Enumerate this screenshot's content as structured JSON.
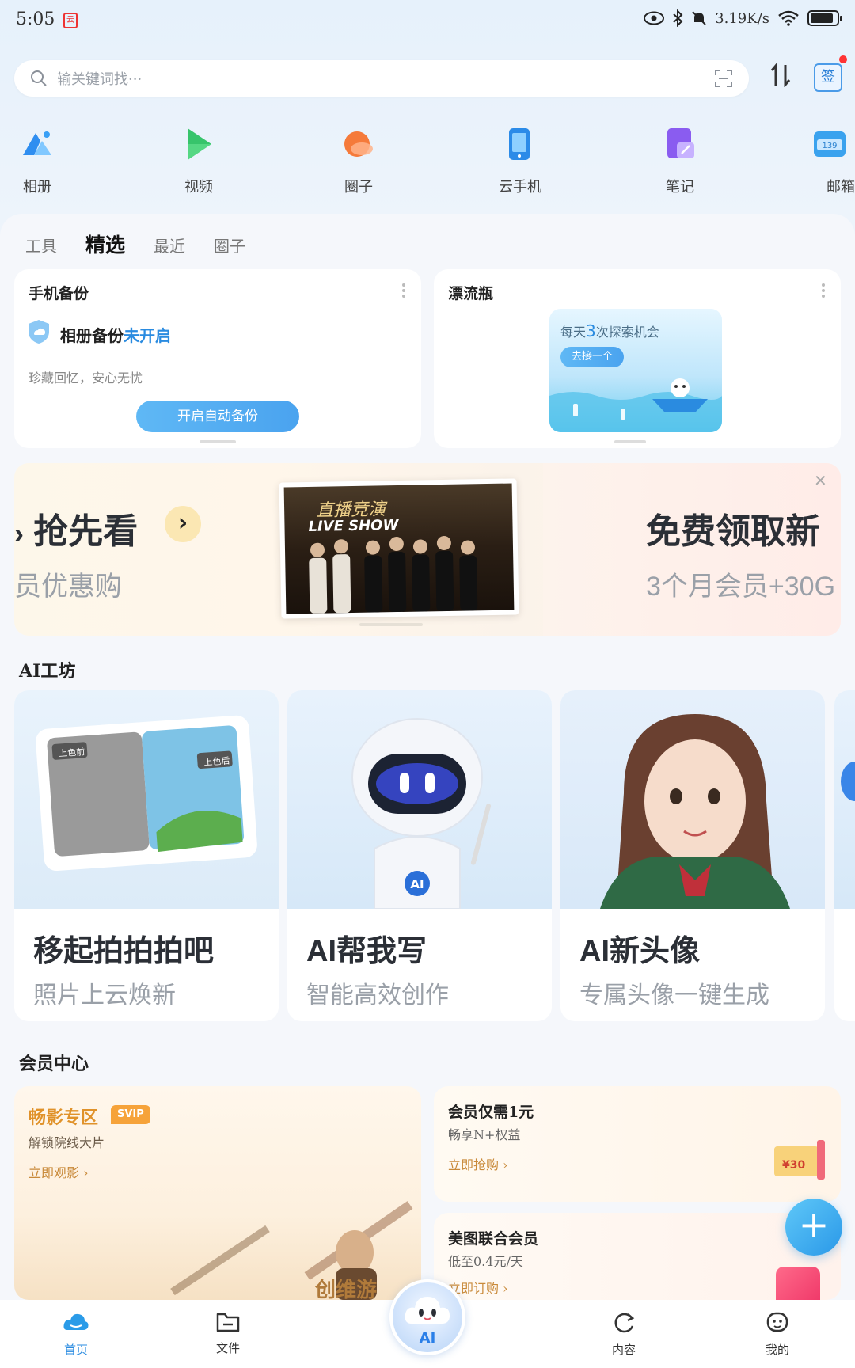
{
  "status_bar": {
    "time": "5:05",
    "network_speed": "3.19K/s"
  },
  "search": {
    "placeholder": "输关键词找···"
  },
  "quick_apps": [
    {
      "label": "相册",
      "icon": "album-icon",
      "color": "#2f8ef0"
    },
    {
      "label": "视频",
      "icon": "video-icon",
      "color": "#37c46b"
    },
    {
      "label": "圈子",
      "icon": "circle-icon",
      "color": "#f57a3a"
    },
    {
      "label": "云手机",
      "icon": "cloud-phone-icon",
      "color": "#2b8be8"
    },
    {
      "label": "笔记",
      "icon": "notes-icon",
      "color": "#8a5cf0"
    },
    {
      "label": "邮箱",
      "icon": "mail-icon",
      "color": "#3aa2ee"
    }
  ],
  "sign_label": "签",
  "tabs": [
    {
      "label": "工具",
      "active": false
    },
    {
      "label": "精选",
      "active": true
    },
    {
      "label": "最近",
      "active": false
    },
    {
      "label": "圈子",
      "active": false
    }
  ],
  "backup_card": {
    "title": "手机备份",
    "status_prefix": "相册备份",
    "status_suffix": "未开启",
    "desc": "珍藏回忆，安心无忧",
    "button": "开启自动备份"
  },
  "bottle_card": {
    "title": "漂流瓶",
    "promo_prefix": "每天",
    "promo_number": "3",
    "promo_suffix": "次探索机会",
    "button": "去接一个"
  },
  "banner": {
    "left_title": "抢先看",
    "left_sub": "员优惠购",
    "poster_title": "直播竞演",
    "poster_sub": "LIVE SHOW",
    "right_title": "免费领取新",
    "right_sub": "3个月会员+30G"
  },
  "ai_section": {
    "title": "AI工坊",
    "cards": [
      {
        "title": "移起拍拍拍吧",
        "sub": "照片上云焕新",
        "tag_before": "上色前",
        "tag_after": "上色后"
      },
      {
        "title": "AI帮我写",
        "sub": "智能高效创作",
        "robot_badge": "AI"
      },
      {
        "title": "AI新头像",
        "sub": "专属头像一键生成"
      }
    ]
  },
  "member_section": {
    "title": "会员中心",
    "movie": {
      "title": "畅影专区",
      "badge": "SVIP",
      "sub": "解锁院线大片",
      "link": "立即观影 ›",
      "poster_text": "创维游"
    },
    "deal1": {
      "title": "会员仅需1元",
      "sub": "畅享N+权益",
      "link": "立即抢购 ›"
    },
    "deal2": {
      "title": "美图联合会员",
      "sub": "低至0.4元/天",
      "link": "立即订购 ›"
    }
  },
  "bottom_nav": [
    {
      "label": "首页",
      "icon": "home-cloud-icon",
      "active": true
    },
    {
      "label": "文件",
      "icon": "folder-icon",
      "active": false
    },
    {
      "label": "AI",
      "icon": "ai-assistant-icon",
      "active": false
    },
    {
      "label": "内容",
      "icon": "content-icon",
      "active": false
    },
    {
      "label": "我的",
      "icon": "profile-icon",
      "active": false
    }
  ],
  "fab_label": "+"
}
